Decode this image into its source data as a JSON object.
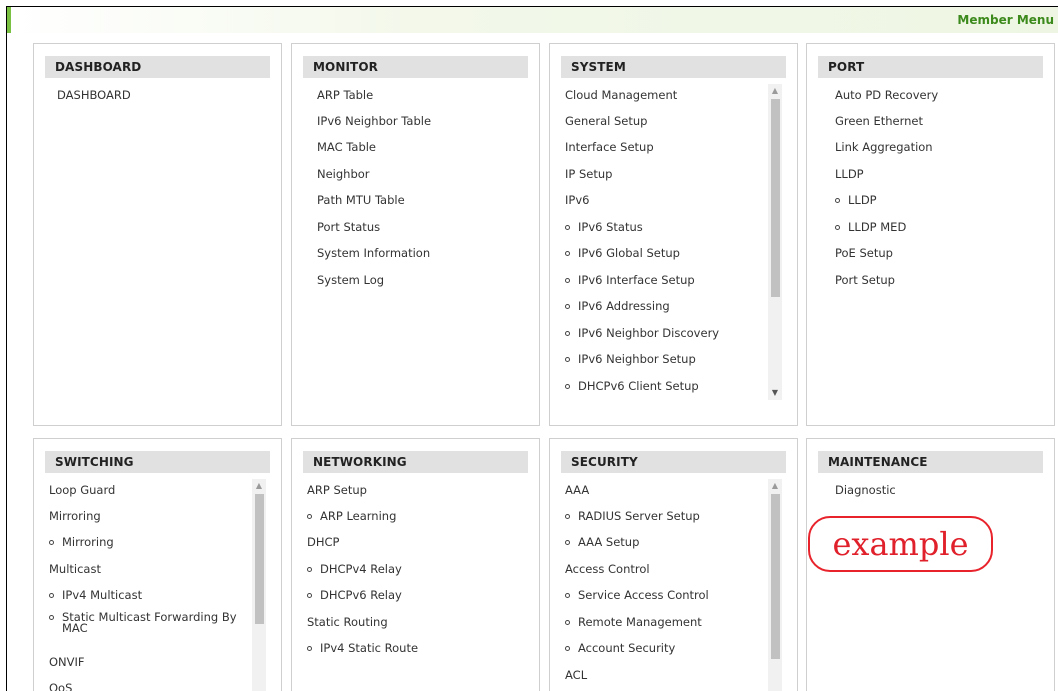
{
  "header": {
    "title": "Member Menu"
  },
  "panels": [
    {
      "title": "DASHBOARD",
      "items": [
        "DASHBOARD"
      ]
    },
    {
      "title": "MONITOR",
      "items": [
        "ARP Table",
        "IPv6 Neighbor Table",
        "MAC Table",
        "Neighbor",
        "Path MTU Table",
        "Port Status",
        "System Information",
        "System Log"
      ]
    },
    {
      "title": "SYSTEM",
      "items": [
        "Cloud Management",
        "General Setup",
        "Interface Setup",
        "IP Setup",
        "IPv6",
        "IPv6 Status",
        "IPv6 Global Setup",
        "IPv6 Interface Setup",
        "IPv6 Addressing",
        "IPv6 Neighbor Discovery",
        "IPv6 Neighbor Setup",
        "DHCPv6 Client Setup"
      ]
    },
    {
      "title": "PORT",
      "items": [
        "Auto PD Recovery",
        "Green Ethernet",
        "Link Aggregation",
        "LLDP",
        "LLDP",
        "LLDP MED",
        "PoE Setup",
        "Port Setup"
      ]
    },
    {
      "title": "SWITCHING",
      "items": [
        "Loop Guard",
        "Mirroring",
        "Mirroring",
        "Multicast",
        "IPv4 Multicast",
        "Static Multicast Forwarding By MAC",
        "ONVIF",
        "QoS"
      ]
    },
    {
      "title": "NETWORKING",
      "items": [
        "ARP Setup",
        "ARP Learning",
        "DHCP",
        "DHCPv4 Relay",
        "DHCPv6 Relay",
        "Static Routing",
        "IPv4 Static Route"
      ]
    },
    {
      "title": "SECURITY",
      "items": [
        "AAA",
        "RADIUS Server Setup",
        "AAA Setup",
        "Access Control",
        "Service Access Control",
        "Remote Management",
        "Account Security",
        "ACL"
      ]
    },
    {
      "title": "MAINTENANCE",
      "items": [
        "Diagnostic"
      ]
    }
  ],
  "stamp": {
    "text": "example"
  },
  "icons": {
    "bullet": "bullet-circle-icon",
    "scroll_up": "scroll-up-arrow-icon",
    "scroll_down": "scroll-down-arrow-icon"
  }
}
